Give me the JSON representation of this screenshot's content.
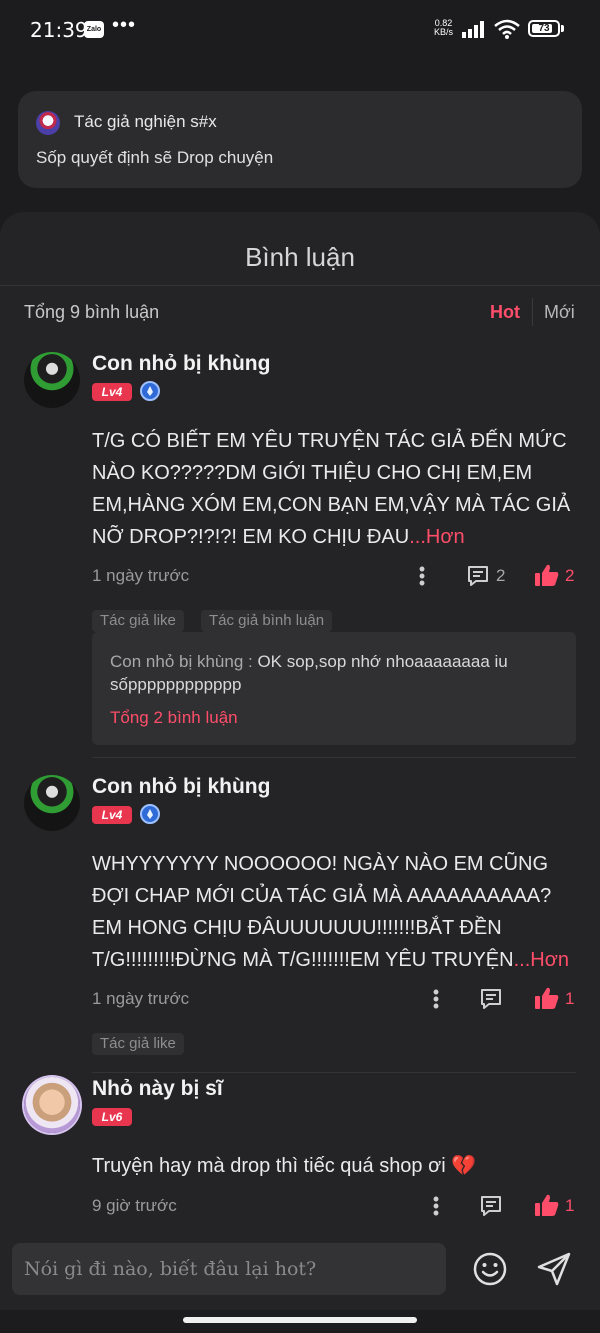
{
  "status_bar": {
    "time": "21:39",
    "zalo": "Zalo",
    "dots": "•••",
    "net_speed": "0.82",
    "net_unit": "KB/s",
    "battery": "73"
  },
  "notification": {
    "author": "Tác giả nghiện s#x",
    "message": "Sốp quyết định sẽ Drop chuyện"
  },
  "sheet": {
    "title": "Bình luận",
    "total": "Tổng 9 bình luận",
    "tab_hot": "Hot",
    "tab_new": "Mới"
  },
  "comments": [
    {
      "name": "Con nhỏ bị khùng",
      "level": "Lv4",
      "text": "T/G CÓ BIẾT EM YÊU TRUYỆN TÁC GIẢ ĐẾN MỨC NÀO KO?????DM GIỚI THIỆU CHO CHỊ EM,EM EM,HÀNG XÓM EM,CON BẠN EM,VẬY MÀ TÁC GIẢ NỠ DROP?!?!?! EM KO CHỊU ĐAU",
      "more": "...Hơn",
      "time": "1 ngày trước",
      "comment_count": "2",
      "like_count": "2",
      "tags": [
        "Tác giả like",
        "Tác giả bình luận"
      ],
      "reply": {
        "author": "Con nhỏ bị khùng : ",
        "text": "OK sop,sop nhớ nhoaaaaaaaa iu sốpppppppppppp",
        "more": "Tổng 2 bình luận"
      }
    },
    {
      "name": "Con nhỏ bị khùng",
      "level": "Lv4",
      "text": "WHYYYYYYY NOOOOOO! NGÀY NÀO EM CŨNG ĐỢI CHAP MỚI CỦA TÁC GIẢ MÀ AAAAAAAAAA? EM HONG CHỊU ĐÂUUUUUUU!!!!!!!BẮT ĐỀN T/G!!!!!!!!!ĐỪNG MÀ T/G!!!!!!!EM YÊU TRUYỆN",
      "more": "...Hơn",
      "time": "1 ngày trước",
      "comment_count": "",
      "like_count": "1",
      "tags": [
        "Tác giả like"
      ]
    },
    {
      "name": "Nhỏ này bị sĩ",
      "level": "Lv6",
      "text": "Truyện hay mà drop thì tiếc quá shop ơi 💔",
      "time": "9 giờ trước",
      "comment_count": "",
      "like_count": "1"
    }
  ],
  "input": {
    "placeholder": "Nói gì đi nào, biết đâu lại hot?"
  },
  "icons": {
    "comment": "chat-bubble-icon",
    "like": "thumbs-up-icon",
    "emoji": "smiley-icon",
    "send": "send-icon",
    "more": "kebab-menu-icon"
  },
  "colors": {
    "accent": "#ff4d6a",
    "background": "#1c1c1e",
    "sheet": "#242426"
  }
}
